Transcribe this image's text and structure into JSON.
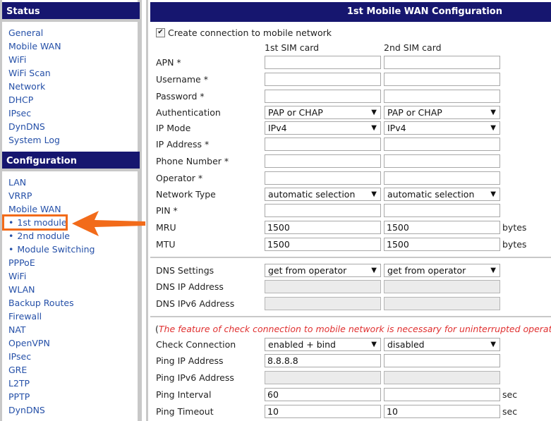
{
  "sidebar": {
    "status_header": "Status",
    "status_items": [
      "General",
      "Mobile WAN",
      "WiFi",
      "WiFi Scan",
      "Network",
      "DHCP",
      "IPsec",
      "DynDNS",
      "System Log"
    ],
    "config_header": "Configuration",
    "config_items": [
      "LAN",
      "VRRP",
      "Mobile WAN"
    ],
    "sub_items": [
      "1st module",
      "2nd module",
      "Module Switching"
    ],
    "config_items_2": [
      "PPPoE",
      "WiFi",
      "WLAN",
      "Backup Routes",
      "Firewall",
      "NAT",
      "OpenVPN",
      "IPsec",
      "GRE",
      "L2TP",
      "PPTP",
      "DynDNS"
    ],
    "highlight_color": "#f26b1a"
  },
  "main": {
    "title": "1st Mobile WAN Configuration",
    "create_connection_label": "Create connection to mobile network",
    "create_connection_checked": true,
    "col1": "1st SIM card",
    "col2": "2nd SIM card",
    "fields": {
      "apn": "APN *",
      "username": "Username *",
      "password": "Password *",
      "authentication": "Authentication",
      "ip_mode": "IP Mode",
      "ip_address": "IP Address *",
      "phone_number": "Phone Number *",
      "operator": "Operator *",
      "network_type": "Network Type",
      "pin": "PIN *",
      "mru": "MRU",
      "mtu": "MTU",
      "dns_settings": "DNS Settings",
      "dns_ip": "DNS IP Address",
      "dns_ipv6": "DNS IPv6 Address",
      "check_connection": "Check Connection",
      "ping_ip": "Ping IP Address",
      "ping_ipv6": "Ping IPv6 Address",
      "ping_interval": "Ping Interval",
      "ping_timeout": "Ping Timeout"
    },
    "values": {
      "auth_1": "PAP or CHAP",
      "auth_2": "PAP or CHAP",
      "ipmode_1": "IPv4",
      "ipmode_2": "IPv4",
      "nettype_1": "automatic selection",
      "nettype_2": "automatic selection",
      "mru_1": "1500",
      "mru_2": "1500",
      "mtu_1": "1500",
      "mtu_2": "1500",
      "dns_1": "get from operator",
      "dns_2": "get from operator",
      "check_1": "enabled + bind",
      "check_2": "disabled",
      "ping_ip_1": "8.8.8.8",
      "ping_interval_1": "60",
      "ping_timeout_1": "10",
      "ping_timeout_2": "10"
    },
    "units": {
      "bytes": "bytes",
      "sec": "sec"
    },
    "note_open": "(",
    "note_text": "The feature of check connection to mobile network is necessary for uninterrupted operation",
    "note_close": ")"
  }
}
